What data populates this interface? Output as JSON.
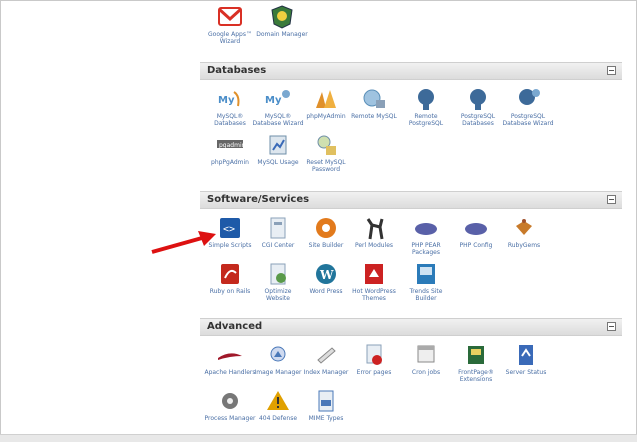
{
  "top_icons": [
    {
      "label": "Google Apps™ Wizard",
      "icon": "gmail-icon",
      "color": "#d93025"
    },
    {
      "label": "Domain Manager",
      "icon": "domain-manager-icon",
      "color": "#3a7a3a"
    }
  ],
  "sections": [
    {
      "title": "Databases",
      "icons": [
        {
          "label": "MySQL® Databases",
          "icon": "mysql-icon",
          "color": "#4b8ec9"
        },
        {
          "label": "MySQL® Database Wizard",
          "icon": "mysql-wizard-icon",
          "color": "#4b8ec9"
        },
        {
          "label": "phpMyAdmin",
          "icon": "phpmyadmin-icon",
          "color": "#e0902a"
        },
        {
          "label": "Remote MySQL",
          "icon": "remote-mysql-icon",
          "color": "#5a8fb8"
        },
        {
          "label": "Remote PostgreSQL",
          "icon": "remote-postgresql-icon",
          "color": "#3d6a99"
        },
        {
          "label": "PostgreSQL Databases",
          "icon": "postgresql-icon",
          "color": "#3d6a99"
        },
        {
          "label": "PostgreSQL Database Wizard",
          "icon": "postgresql-wizard-icon",
          "color": "#3d6a99"
        },
        {
          "label": "phpPgAdmin",
          "icon": "phppgadmin-icon",
          "color": "#555555"
        },
        {
          "label": "MySQL Usage",
          "icon": "mysql-usage-icon",
          "color": "#6f8fa8"
        },
        {
          "label": "Reset MySQL Password",
          "icon": "reset-mysql-password-icon",
          "color": "#6f8fa8"
        }
      ]
    },
    {
      "title": "Software/Services",
      "icons": [
        {
          "label": "Simple Scripts",
          "icon": "simple-scripts-icon",
          "color": "#1e5aa8"
        },
        {
          "label": "CGI Center",
          "icon": "cgi-center-icon",
          "color": "#8aa0b8"
        },
        {
          "label": "Site Builder",
          "icon": "site-builder-icon",
          "color": "#e27a1c"
        },
        {
          "label": "Perl Modules",
          "icon": "perl-modules-icon",
          "color": "#333333"
        },
        {
          "label": "PHP PEAR Packages",
          "icon": "php-pear-icon",
          "color": "#5960a8"
        },
        {
          "label": "PHP Config",
          "icon": "php-config-icon",
          "color": "#5960a8"
        },
        {
          "label": "RubyGems",
          "icon": "rubygems-icon",
          "color": "#a0522d"
        },
        {
          "label": "Ruby on Rails",
          "icon": "ruby-on-rails-icon",
          "color": "#c4291d"
        },
        {
          "label": "Optimize Website",
          "icon": "optimize-website-icon",
          "color": "#5a9a4a"
        },
        {
          "label": "Word Press",
          "icon": "wordpress-icon",
          "color": "#21759b"
        },
        {
          "label": "Hot WordPress Themes",
          "icon": "wordpress-themes-icon",
          "color": "#cc2222"
        },
        {
          "label": "Trends Site Builder",
          "icon": "trends-site-builder-icon",
          "color": "#2b7bb9"
        }
      ]
    },
    {
      "title": "Advanced",
      "icons": [
        {
          "label": "Apache Handlers",
          "icon": "apache-handlers-icon",
          "color": "#a0182a"
        },
        {
          "label": "Image Manager",
          "icon": "image-manager-icon",
          "color": "#4a78b8"
        },
        {
          "label": "Index Manager",
          "icon": "index-manager-icon",
          "color": "#888888"
        },
        {
          "label": "Error pages",
          "icon": "error-pages-icon",
          "color": "#cc2222"
        },
        {
          "label": "Cron jobs",
          "icon": "cron-jobs-icon",
          "color": "#8a8a8a"
        },
        {
          "label": "FrontPage® Extensions",
          "icon": "frontpage-icon",
          "color": "#2a6a3a"
        },
        {
          "label": "Server Status",
          "icon": "server-status-icon",
          "color": "#3a6ab8"
        },
        {
          "label": "Process Manager",
          "icon": "process-manager-icon",
          "color": "#555555"
        },
        {
          "label": "404 Defense",
          "icon": "defense-404-icon",
          "color": "#e0a000"
        },
        {
          "label": "MIME Types",
          "icon": "mime-types-icon",
          "color": "#4a78b8"
        }
      ]
    }
  ],
  "annotation": {
    "icon": "red-arrow-icon",
    "color": "#dd1111"
  }
}
